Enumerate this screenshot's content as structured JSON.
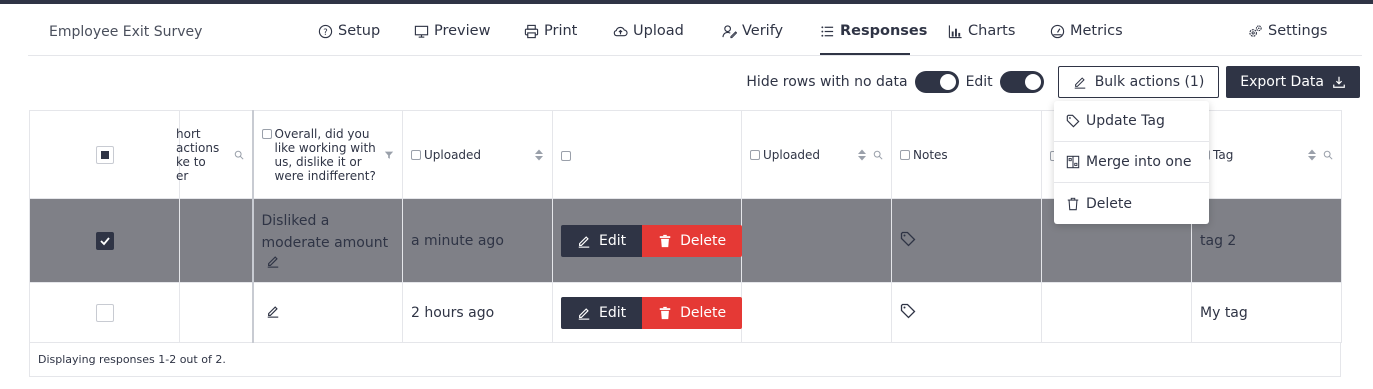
{
  "survey_title": "Employee Exit Survey",
  "nav": {
    "setup": "Setup",
    "preview": "Preview",
    "print": "Print",
    "upload": "Upload",
    "verify": "Verify",
    "responses": "Responses",
    "charts": "Charts",
    "metrics": "Metrics",
    "settings": "Settings"
  },
  "toolbar": {
    "hide_rows_label": "Hide rows with no data",
    "edit_label": "Edit",
    "bulk_actions": "Bulk actions (1)",
    "export": "Export Data"
  },
  "bulk_menu": [
    "Update Tag",
    "Merge into one",
    "Delete"
  ],
  "columns": {
    "truncated": "hort\nactions\nke to\ner",
    "question": "Overall, did you like working with us, dislike it or were indifferent?",
    "uploaded1": "Uploaded",
    "uploaded2": "Uploaded",
    "notes": "Notes",
    "tag": "Tag"
  },
  "rows": [
    {
      "answer": "Disliked a moderate amount",
      "uploaded": "a minute ago",
      "edit": "Edit",
      "delete": "Delete",
      "tag": "tag 2",
      "selected": true
    },
    {
      "answer": "",
      "uploaded": "2 hours ago",
      "edit": "Edit",
      "delete": "Delete",
      "tag": "My tag",
      "selected": false
    }
  ],
  "footer": "Displaying responses 1-2 out of 2.",
  "icons": [
    "question-circle-icon",
    "monitor-icon",
    "printer-icon",
    "cloud-upload-icon",
    "verify-icon",
    "list-icon",
    "bar-chart-icon",
    "gauge-icon",
    "gears-icon",
    "pencil-icon",
    "download-icon",
    "tag-icon",
    "merge-icon",
    "trash-icon",
    "search-icon",
    "sort-icon",
    "filter-icon",
    "check-icon"
  ],
  "colors": {
    "dark": "#2f3445",
    "danger": "#e53935",
    "selected_row": "#7f8087"
  }
}
